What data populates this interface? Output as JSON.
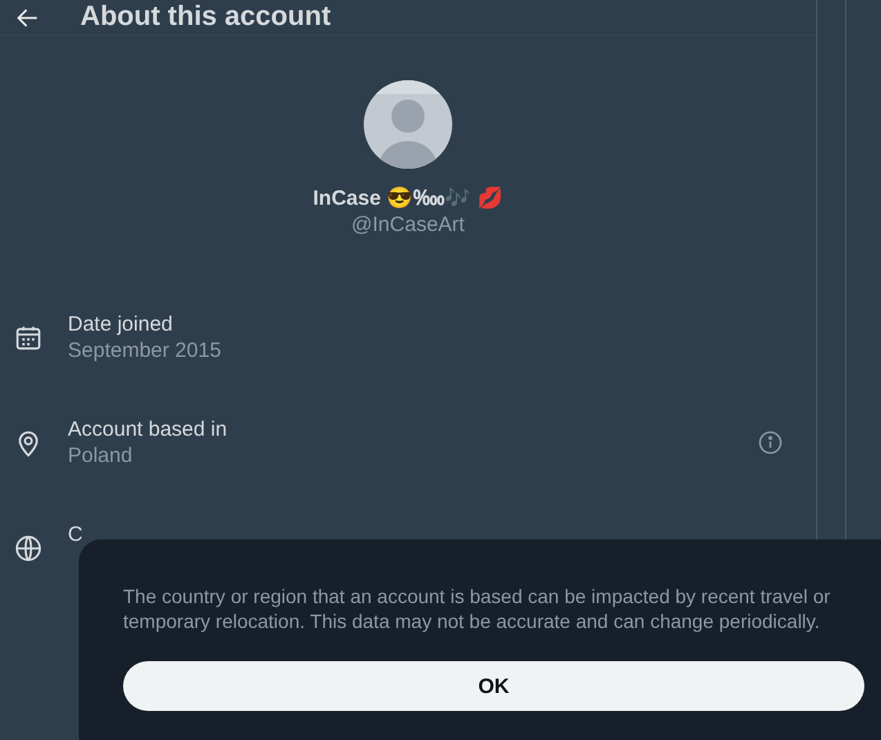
{
  "header": {
    "title": "About this account"
  },
  "profile": {
    "name": "InCase 😎‱🎶 💋",
    "handle": "@InCaseArt"
  },
  "rows": [
    {
      "kind": "date",
      "label": "Date joined",
      "value": "September 2015",
      "info": false
    },
    {
      "kind": "location",
      "label": "Account based in",
      "value": "Poland",
      "info": true
    },
    {
      "kind": "globe",
      "label": "C",
      "info": false
    }
  ],
  "popover": {
    "text": "The country or region that an account is based can be impacted by recent travel or temporary relocation. This data may not be accurate and can change periodically.",
    "button": "OK"
  }
}
